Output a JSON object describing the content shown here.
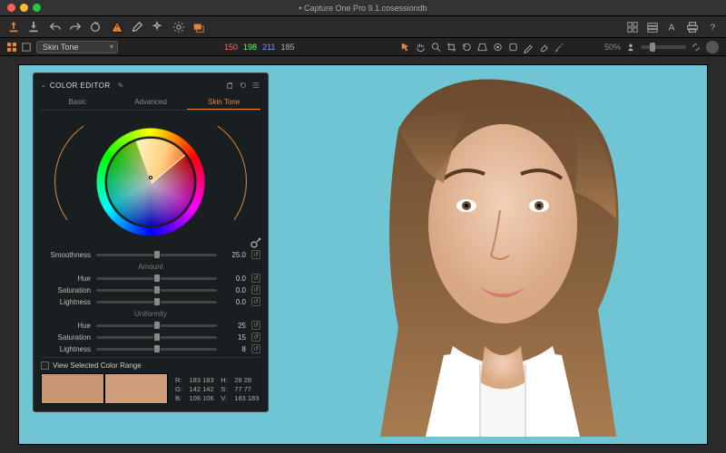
{
  "window": {
    "title": "Capture One Pro 9.1.cosessiondb",
    "modified": "•"
  },
  "secbar": {
    "tool_dropdown": "Skin Tone",
    "rgb": {
      "r": "150",
      "g": "198",
      "b": "211",
      "a": "185"
    },
    "zoom": "50%"
  },
  "panel": {
    "title": "COLOR EDITOR",
    "tabs": [
      "Basic",
      "Advanced",
      "Skin Tone"
    ],
    "active_tab": 2,
    "smoothness": {
      "label": "Smoothness",
      "value": "25.0"
    },
    "amount_label": "Amount",
    "amount": {
      "hue": {
        "label": "Hue",
        "value": "0.0"
      },
      "saturation": {
        "label": "Saturation",
        "value": "0.0"
      },
      "lightness": {
        "label": "Lightness",
        "value": "0.0"
      }
    },
    "uniformity_label": "Uniformity",
    "uniformity": {
      "hue": {
        "label": "Hue",
        "value": "25"
      },
      "saturation": {
        "label": "Saturation",
        "value": "15"
      },
      "lightness": {
        "label": "Lightness",
        "value": "8"
      }
    },
    "view_range_label": "View Selected Color Range",
    "swatches": [
      "#c89773",
      "#cf9f7c"
    ],
    "readout": {
      "R": "183",
      "R2": "183",
      "H": "28",
      "H2": "28",
      "G": "142",
      "G2": "142",
      "S": "77",
      "S2": "77",
      "B": "106",
      "B2": "106",
      "V": "183",
      "V2": "183"
    }
  }
}
